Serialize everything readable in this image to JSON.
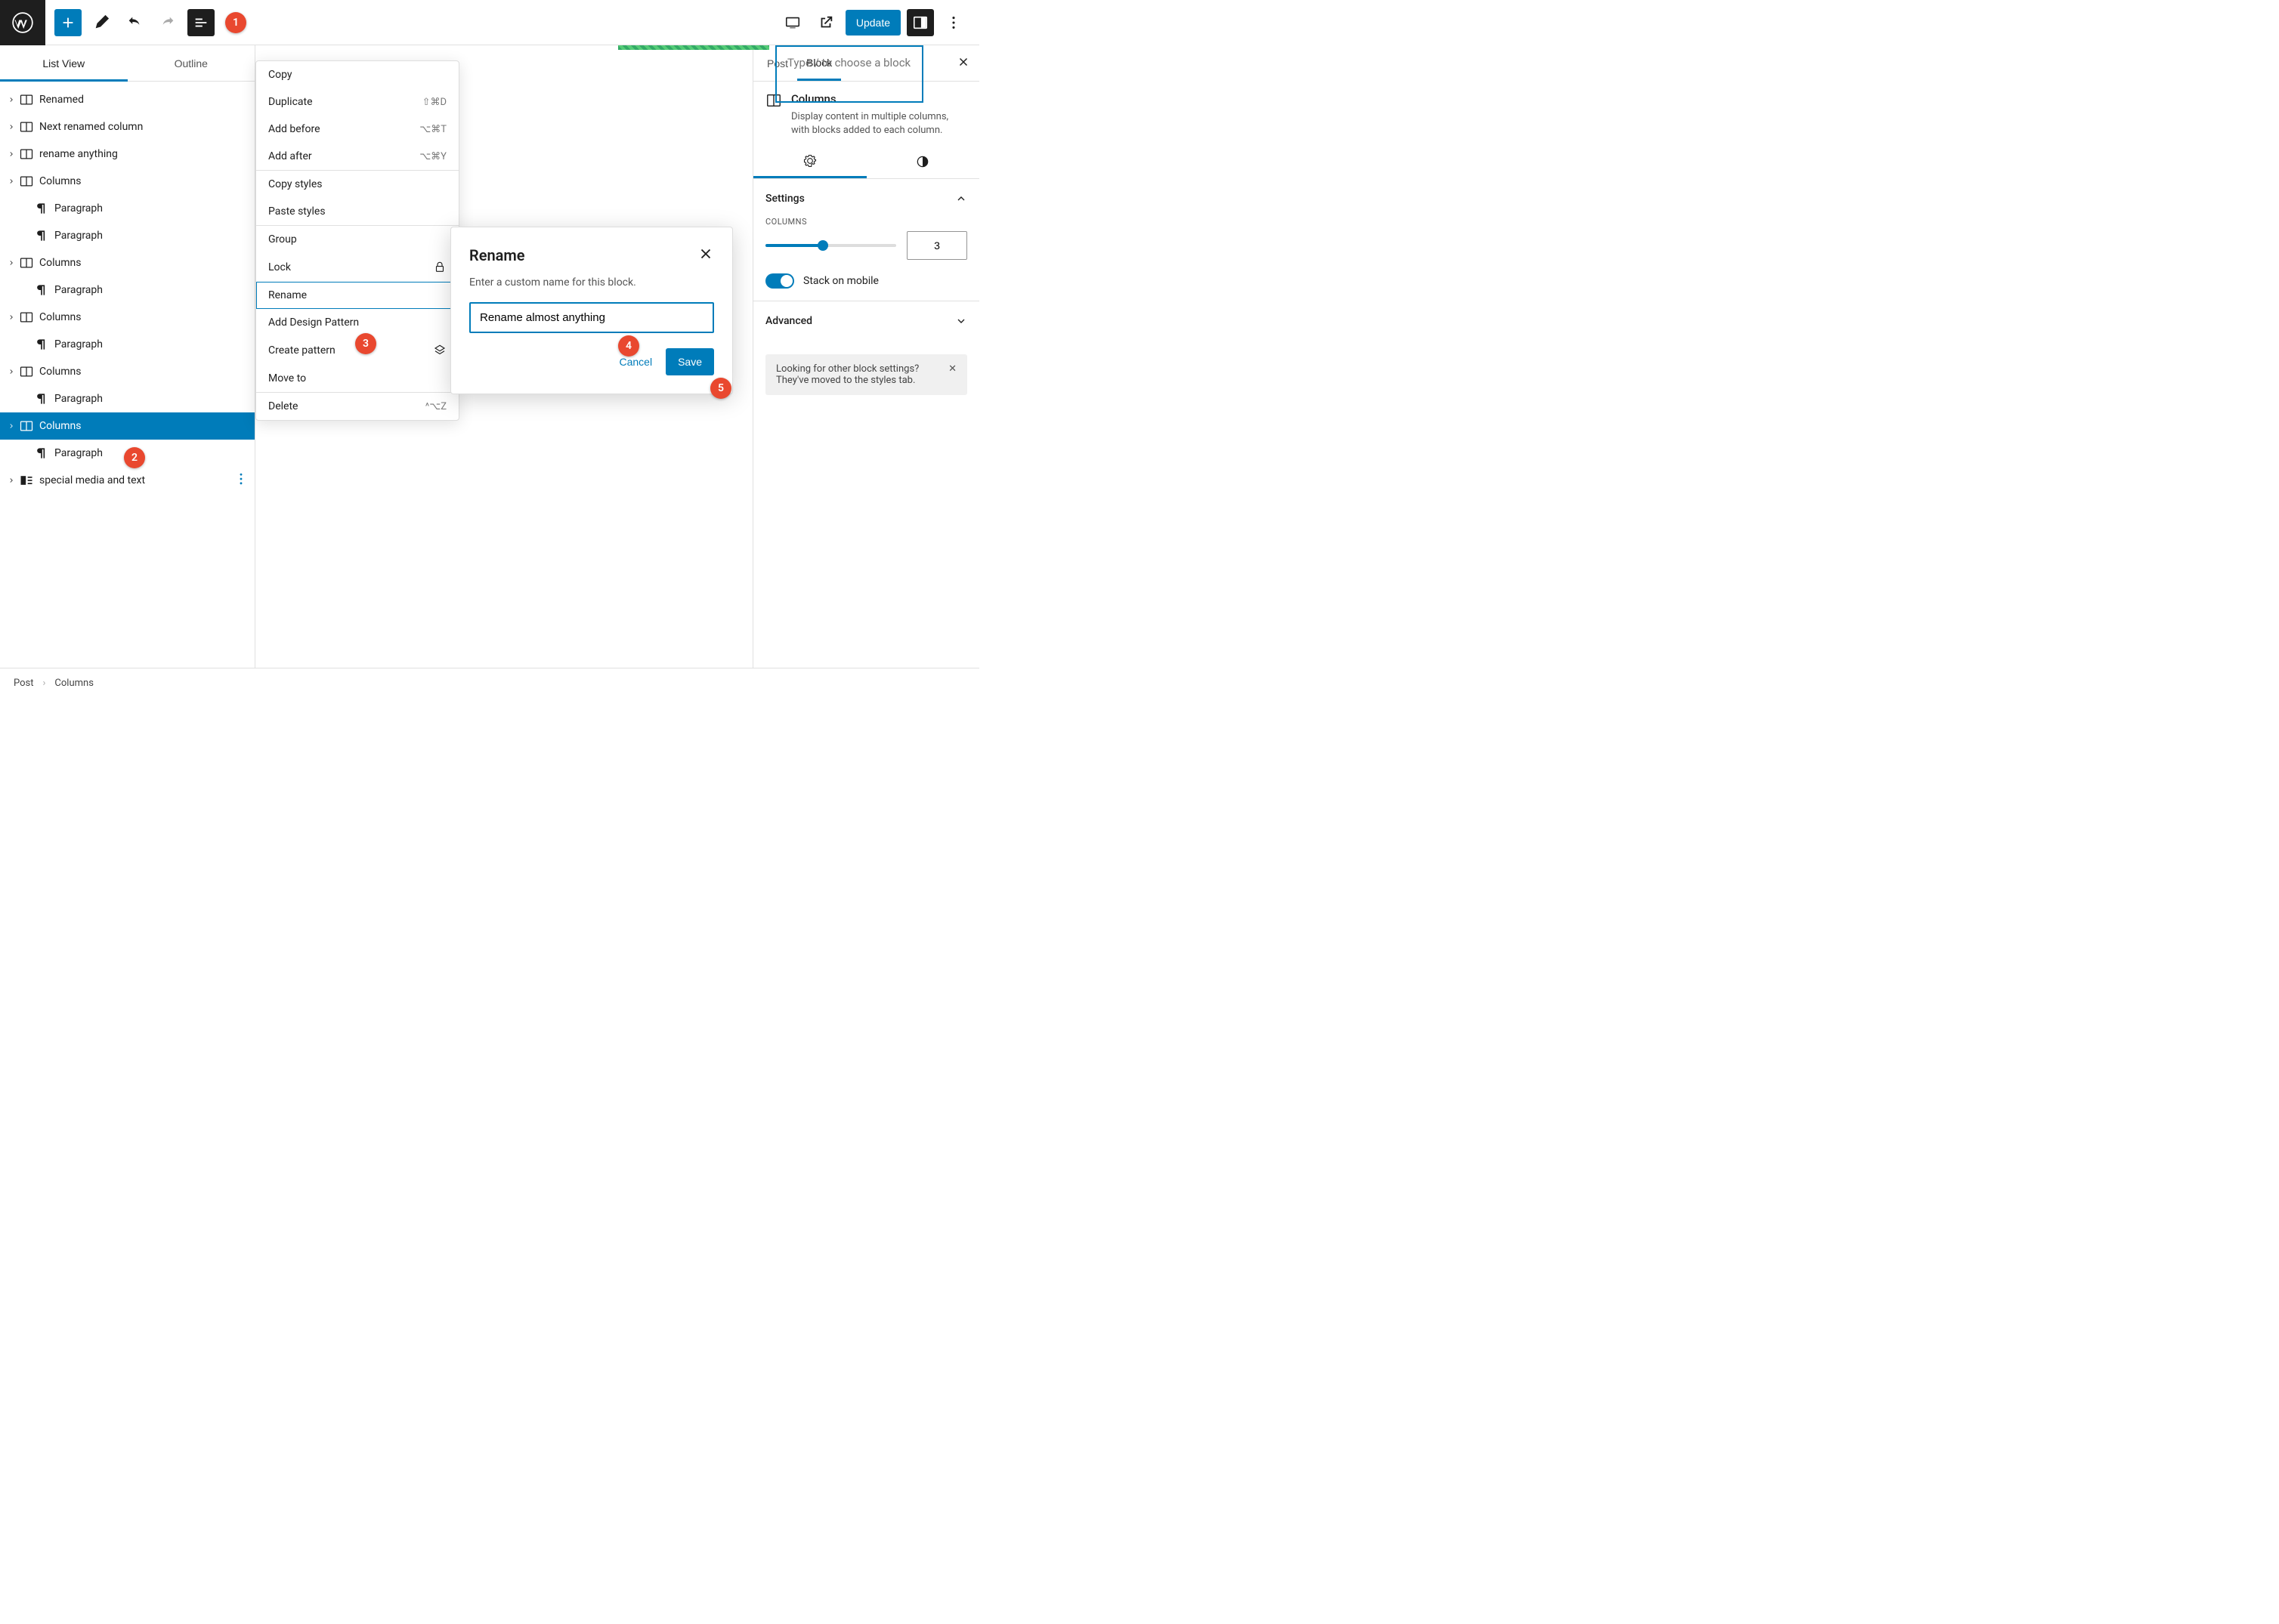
{
  "annotations": {
    "b1": "1",
    "b2": "2",
    "b3": "3",
    "b4": "4",
    "b5": "5"
  },
  "topbar": {
    "update": "Update"
  },
  "left_panel": {
    "tab_listview": "List View",
    "tab_outline": "Outline",
    "items": [
      {
        "label": "Renamed",
        "type": "columns",
        "chev": true
      },
      {
        "label": "Next renamed column",
        "type": "columns",
        "chev": true
      },
      {
        "label": "rename anything",
        "type": "columns",
        "chev": true
      },
      {
        "label": "Columns",
        "type": "columns",
        "chev": true
      },
      {
        "label": "Paragraph",
        "type": "para",
        "indent": true
      },
      {
        "label": "Paragraph",
        "type": "para",
        "indent": true
      },
      {
        "label": "Columns",
        "type": "columns",
        "chev": true
      },
      {
        "label": "Paragraph",
        "type": "para",
        "indent": true
      },
      {
        "label": "Columns",
        "type": "columns",
        "chev": true
      },
      {
        "label": "Paragraph",
        "type": "para",
        "indent": true
      },
      {
        "label": "Columns",
        "type": "columns",
        "chev": true
      },
      {
        "label": "Paragraph",
        "type": "para",
        "indent": true
      },
      {
        "label": "Columns",
        "type": "columns",
        "chev": true,
        "sel": true
      },
      {
        "label": "Paragraph",
        "type": "para",
        "indent": true
      },
      {
        "label": "special media and text",
        "type": "media",
        "chev": true,
        "opts": true
      }
    ]
  },
  "canvas": {
    "placeholder": "Type / to choose a block"
  },
  "ctx": {
    "copy": "Copy",
    "duplicate": "Duplicate",
    "dup_sc": "⇧⌘D",
    "add_before": "Add before",
    "ab_sc": "⌥⌘T",
    "add_after": "Add after",
    "aa_sc": "⌥⌘Y",
    "copy_styles": "Copy styles",
    "paste_styles": "Paste styles",
    "group": "Group",
    "lock": "Lock",
    "rename": "Rename",
    "add_design": "Add Design Pattern",
    "create_pattern": "Create pattern",
    "move_to": "Move to",
    "delete": "Delete",
    "del_sc": "^⌥Z"
  },
  "modal": {
    "title": "Rename",
    "desc": "Enter a custom name for this block.",
    "value": "Rename almost anything",
    "cancel": "Cancel",
    "save": "Save"
  },
  "right": {
    "tab_post": "Post",
    "tab_block": "Block",
    "block_title": "Columns",
    "block_desc": "Display content in multiple columns, with blocks added to each column.",
    "settings": "Settings",
    "columns_label": "COLUMNS",
    "columns_value": "3",
    "stack": "Stack on mobile",
    "advanced": "Advanced",
    "tip": "Looking for other block settings? They've moved to the styles tab."
  },
  "crumbs": {
    "a": "Post",
    "b": "Columns"
  }
}
